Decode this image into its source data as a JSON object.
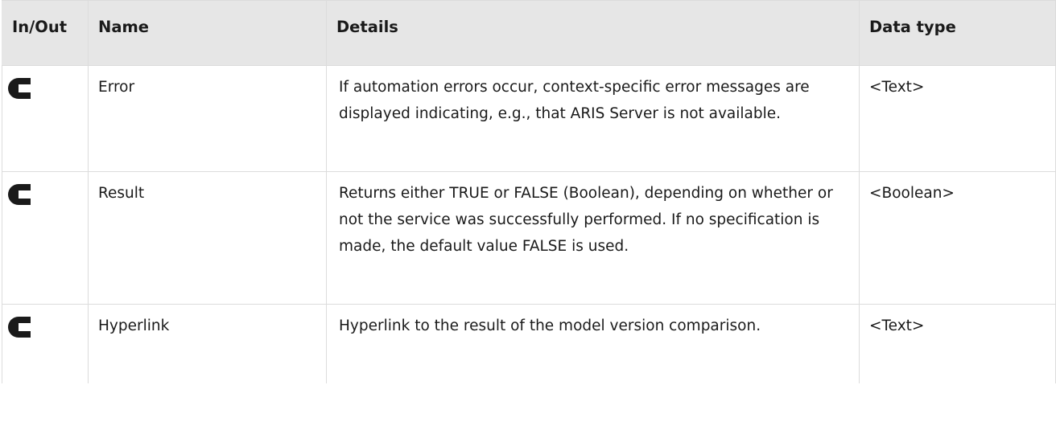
{
  "table": {
    "headers": {
      "io": "In/Out",
      "name": "Name",
      "details": "Details",
      "data_type": "Data type"
    },
    "rows": [
      {
        "direction_icon": "output-arrow-icon",
        "name": "Error",
        "details": "If automation errors occur, context-specific error messages are displayed indicating, e.g., that ARIS Server is not available.",
        "data_type": "<Text>"
      },
      {
        "direction_icon": "output-arrow-icon",
        "name": "Result",
        "details": "Returns either TRUE or FALSE (Boolean), depending on whether or not the service was successfully performed. If no specification is made, the default value FALSE is used.",
        "data_type": "<Boolean>"
      },
      {
        "direction_icon": "output-arrow-icon",
        "name": "Hyperlink",
        "details": "Hyperlink to the result of the model version comparison.",
        "data_type": "<Text>"
      }
    ]
  },
  "colors": {
    "header_bg": "#e6e6e6",
    "border": "#dcdcdc",
    "icon": "#1a1a1a"
  }
}
